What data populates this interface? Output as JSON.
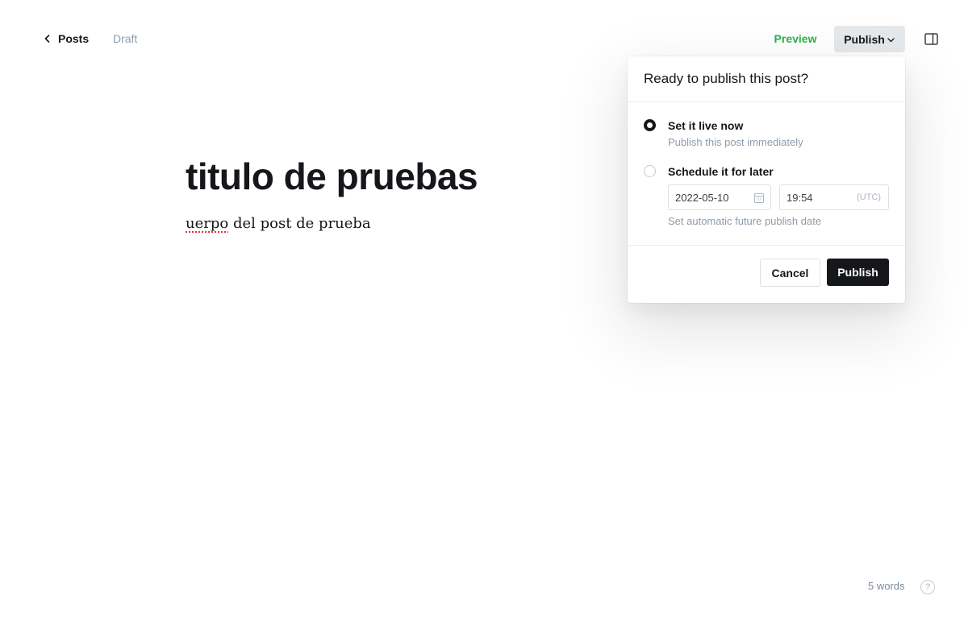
{
  "header": {
    "back_label": "Posts",
    "status": "Draft",
    "preview_label": "Preview",
    "publish_label": "Publish"
  },
  "editor": {
    "title": "titulo de pruebas",
    "body_misspelled": "uerpo",
    "body_rest": " del post de prueba"
  },
  "publish_menu": {
    "heading": "Ready to publish this post?",
    "options": [
      {
        "title": "Set it live now",
        "subtitle": "Publish this post immediately",
        "selected": true
      },
      {
        "title": "Schedule it for later",
        "subtitle": "",
        "selected": false
      }
    ],
    "date_value": "2022-05-10",
    "time_value": "19:54",
    "timezone": "(UTC)",
    "schedule_hint": "Set automatic future publish date",
    "cancel_label": "Cancel",
    "publish_label": "Publish"
  },
  "footer": {
    "word_count": "5 words",
    "help_glyph": "?"
  },
  "colors": {
    "accent_green": "#2bb34a",
    "dark": "#15171a",
    "muted": "#8e9cac"
  }
}
